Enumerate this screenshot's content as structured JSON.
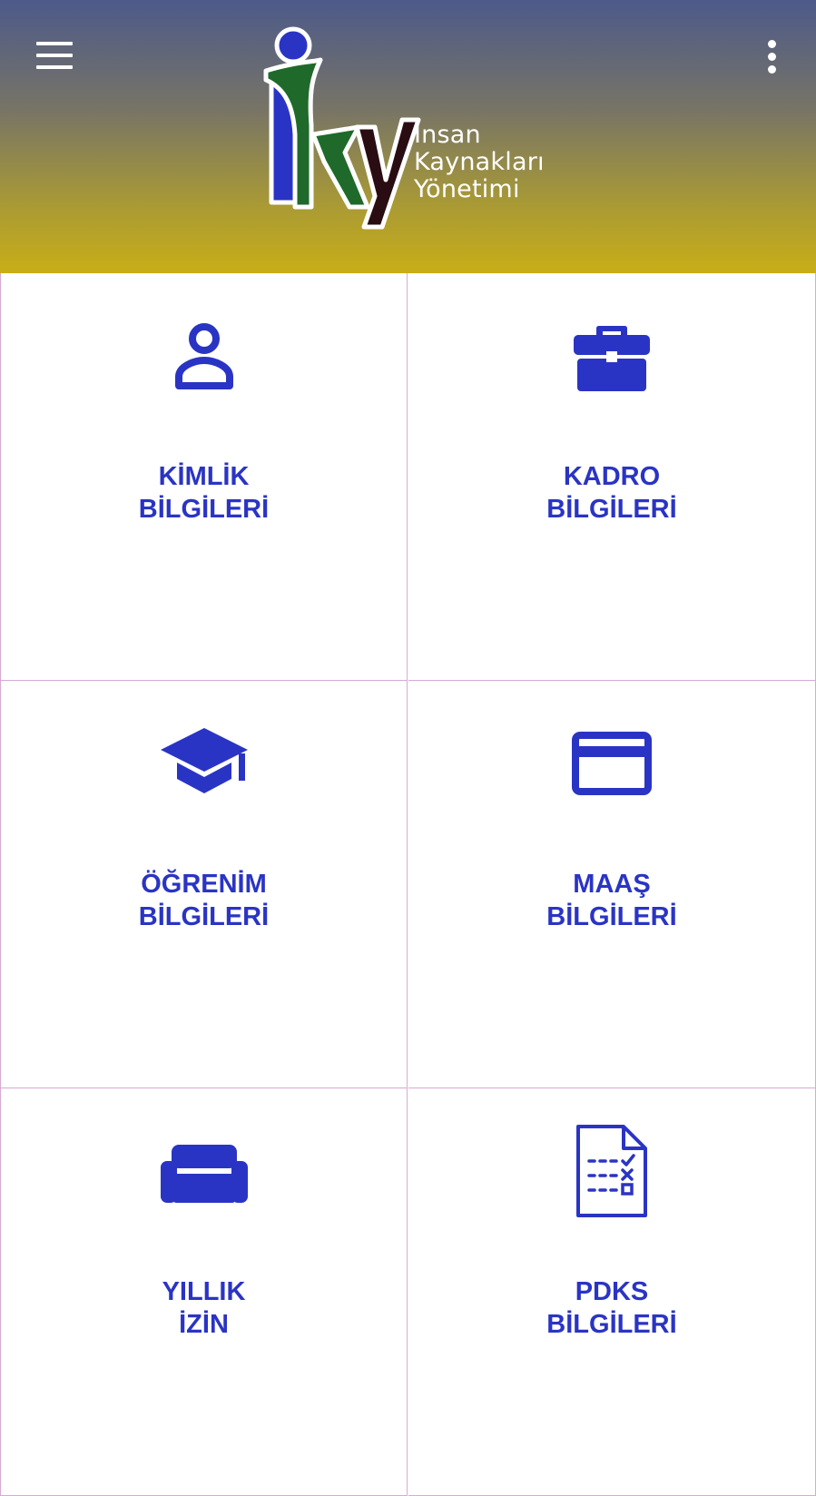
{
  "header": {
    "logo_lines": [
      "İnsan",
      "Kaynakları",
      "Yönetimi"
    ],
    "menu_icon": "hamburger-menu-icon",
    "more_icon": "more-vertical-icon"
  },
  "colors": {
    "accent": "#2a34c4",
    "header_top": "#4d5a8a",
    "header_bottom": "#c8ae17",
    "divider": "#d8a9d3",
    "logo_green": "#1f6a2a",
    "logo_dark": "#2a0d12"
  },
  "tiles": [
    {
      "line1": "KİMLİK",
      "line2": "BİLGİLERİ",
      "icon": "person-icon"
    },
    {
      "line1": "KADRO",
      "line2": "BİLGİLERİ",
      "icon": "briefcase-icon"
    },
    {
      "line1": "ÖĞRENİM",
      "line2": "BİLGİLERİ",
      "icon": "graduation-cap-icon"
    },
    {
      "line1": "MAAŞ",
      "line2": "BİLGİLERİ",
      "icon": "credit-card-icon"
    },
    {
      "line1": "YILLIK",
      "line2": "İZİN",
      "icon": "sofa-icon"
    },
    {
      "line1": "PDKS",
      "line2": "BİLGİLERİ",
      "icon": "checklist-document-icon"
    }
  ]
}
